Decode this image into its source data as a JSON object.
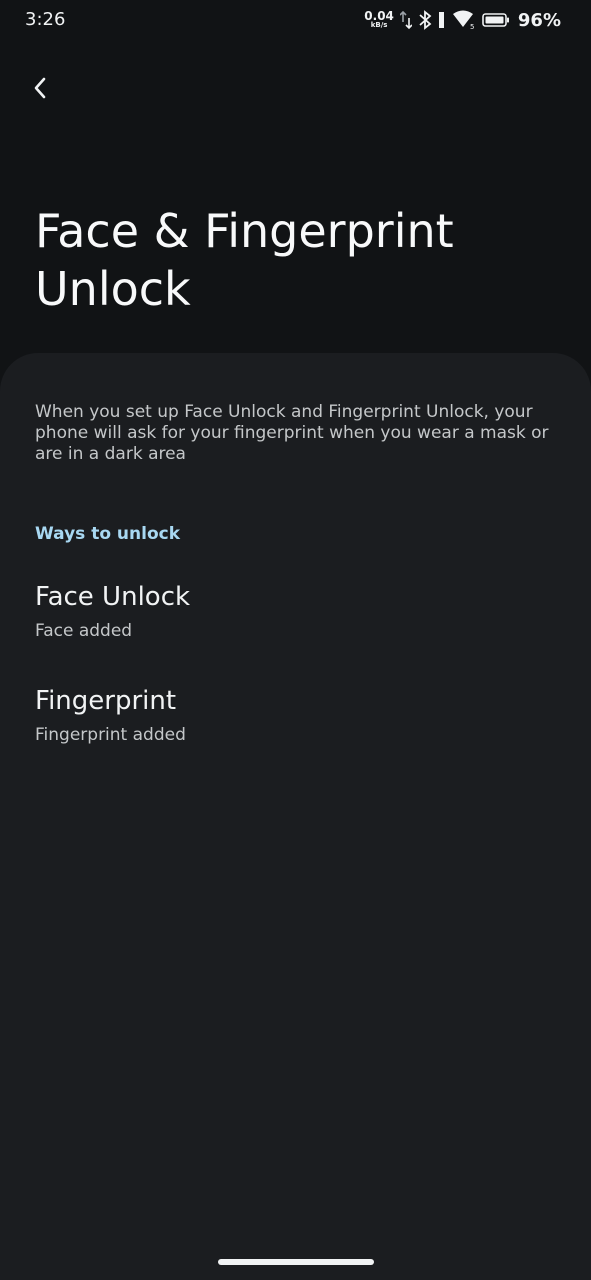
{
  "status_bar": {
    "time": "3:26",
    "net_speed_value": "0.04",
    "net_speed_unit": "kB/s",
    "battery_percent": "96%"
  },
  "header": {
    "back_icon": "chevron-left-icon",
    "title": "Face & Fingerprint Unlock"
  },
  "main": {
    "description": "When you set up Face Unlock and Fingerprint Unlock, your phone will ask for your fingerprint when you wear a mask or are in a dark area",
    "section_title": "Ways to unlock",
    "items": [
      {
        "title": "Face Unlock",
        "subtitle": "Face added"
      },
      {
        "title": "Fingerprint",
        "subtitle": "Fingerprint added"
      }
    ]
  },
  "colors": {
    "background": "#111315",
    "panel": "#1b1d20",
    "accent": "#a8d8f2"
  }
}
